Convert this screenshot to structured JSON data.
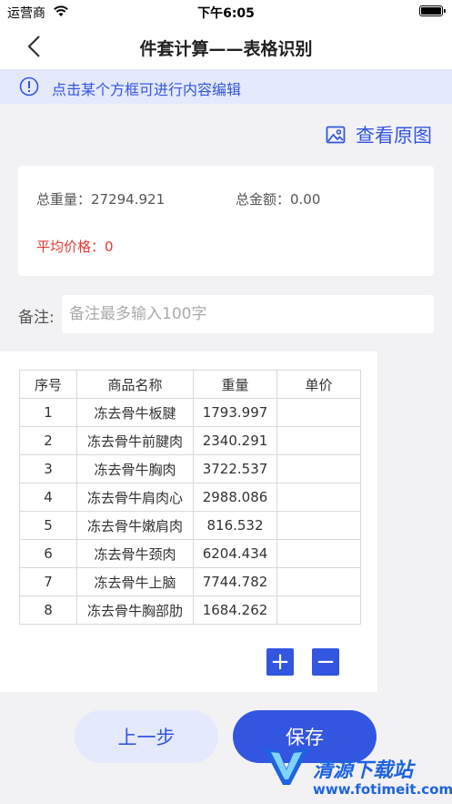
{
  "status_bar": {
    "carrier": "运营商",
    "time": "下午6:05"
  },
  "nav": {
    "title": "件套计算——表格识别"
  },
  "notice": {
    "text": "点击某个方框可进行内容编辑"
  },
  "view_original": {
    "label": "查看原图"
  },
  "summary": {
    "total_weight": "总重量：27294.921",
    "total_amount": "总金额：0.00",
    "avg_price": "平均价格：0"
  },
  "remark": {
    "label": "备注:",
    "placeholder": "备注最多输入100字"
  },
  "table": {
    "headers": [
      "序号",
      "商品名称",
      "重量",
      "单价"
    ],
    "rows": [
      [
        "1",
        "冻去骨牛板腱",
        "1793.997",
        ""
      ],
      [
        "2",
        "冻去骨牛前腱肉",
        "2340.291",
        ""
      ],
      [
        "3",
        "冻去骨牛胸肉",
        "3722.537",
        ""
      ],
      [
        "4",
        "冻去骨牛肩肉心",
        "2988.086",
        ""
      ],
      [
        "5",
        "冻去骨牛嫩肩肉",
        "816.532",
        ""
      ],
      [
        "6",
        "冻去骨牛颈肉",
        "6204.434",
        ""
      ],
      [
        "7",
        "冻去骨牛上脑",
        "7744.782",
        ""
      ],
      [
        "8",
        "冻去骨牛胸部肋",
        "1684.262",
        ""
      ]
    ],
    "add_label": "+",
    "remove_label": "−"
  },
  "buttons": {
    "prev": "上一步",
    "save": "保存"
  },
  "watermark": {
    "title": "清源下载站",
    "url": "www.fotimeit.com"
  },
  "colors": {
    "accent": "#3356e0",
    "notice_bg": "#e4e9fb",
    "warning": "#e53935"
  },
  "icons": [
    "wifi-icon",
    "battery-icon",
    "back-chevron-icon",
    "info-icon",
    "image-icon"
  ]
}
